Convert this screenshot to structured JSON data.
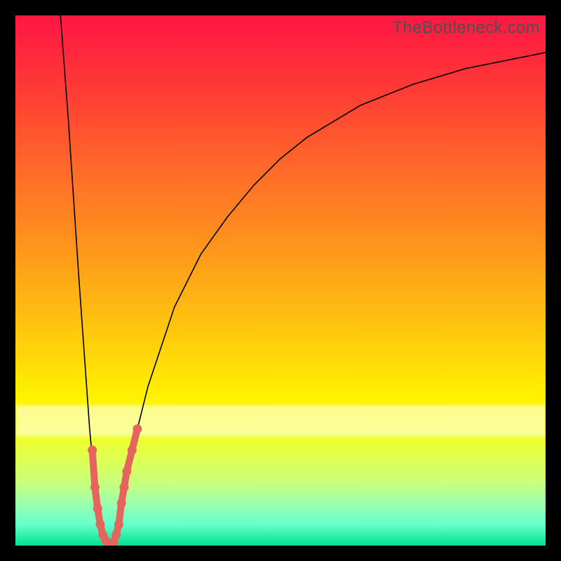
{
  "watermark": "TheBottleneck.com",
  "colors": {
    "background": "#000000",
    "gradient": [
      "#ff1744",
      "#ffd60a",
      "#fff200",
      "#00e38f"
    ],
    "curve": "#000000",
    "markers": "#e5655e"
  },
  "chart_data": {
    "type": "line",
    "title": "",
    "xlabel": "",
    "ylabel": "",
    "xlim": [
      0,
      100
    ],
    "ylim": [
      0,
      100
    ],
    "grid": false,
    "series": [
      {
        "name": "bottleneck_curve",
        "x": [
          8.5,
          10,
          11,
          12,
          13,
          14,
          15,
          16,
          17,
          18,
          18.5,
          19,
          20,
          22,
          25,
          30,
          35,
          40,
          45,
          50,
          55,
          60,
          65,
          70,
          75,
          80,
          85,
          90,
          95,
          100
        ],
        "y": [
          100,
          80,
          65,
          50,
          36,
          22,
          11,
          5,
          1,
          0,
          0.5,
          2,
          8,
          18,
          30,
          45,
          55,
          62,
          68,
          73,
          77,
          80,
          83,
          85,
          87,
          88.5,
          90,
          91,
          92,
          93
        ]
      }
    ],
    "markers": {
      "name": "highlighted_band",
      "x": [
        14.5,
        15,
        15.5,
        16,
        16.5,
        17,
        17.5,
        18,
        18.5,
        19,
        19.5,
        20,
        20.5,
        21,
        22,
        23
      ],
      "y": [
        18,
        11,
        7,
        4,
        2,
        1,
        0.5,
        0,
        0.5,
        2,
        4,
        8,
        11,
        14,
        18,
        22
      ]
    }
  }
}
